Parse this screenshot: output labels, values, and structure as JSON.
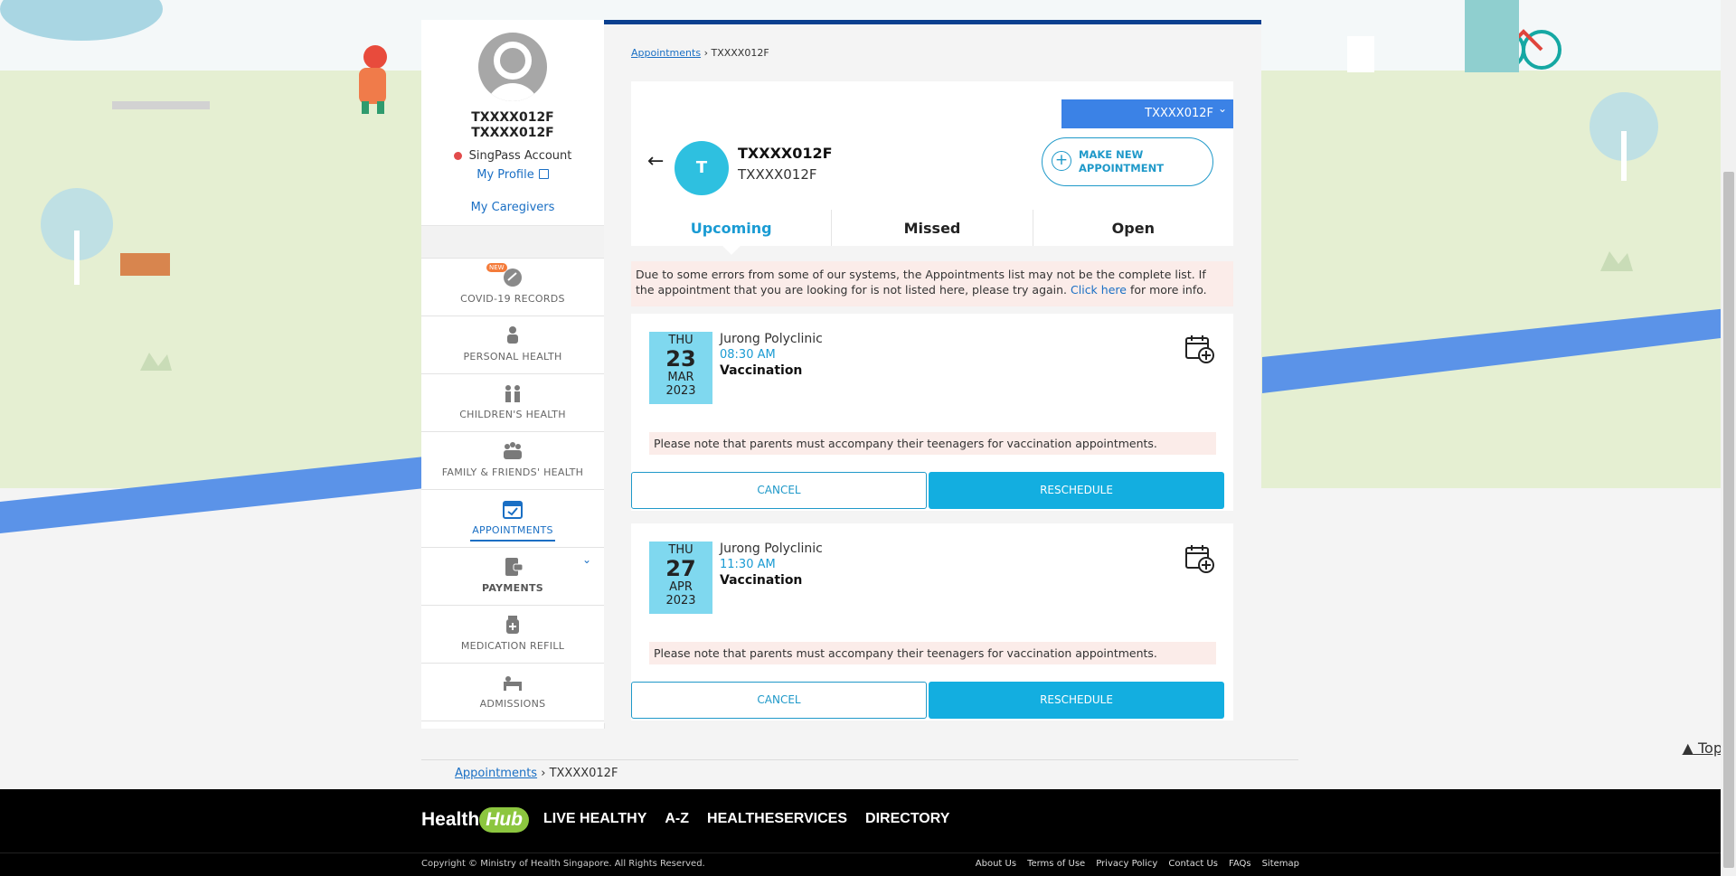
{
  "profile": {
    "name": "TXXXX012F",
    "id": "TXXXX012F",
    "account_type": "SingPass Account",
    "my_profile": "My Profile",
    "my_caregivers": "My Caregivers"
  },
  "sidebar": {
    "items": [
      {
        "label": "COVID-19 RECORDS",
        "icon": "covid-records-icon",
        "badge": "NEW"
      },
      {
        "label": "PERSONAL HEALTH",
        "icon": "person-heart-icon"
      },
      {
        "label": "CHILDREN'S HEALTH",
        "icon": "children-icon"
      },
      {
        "label": "FAMILY & FRIENDS' HEALTH",
        "icon": "family-icon"
      },
      {
        "label": "APPOINTMENTS",
        "icon": "calendar-check-icon",
        "active": true
      },
      {
        "label": "PAYMENTS",
        "icon": "payments-icon"
      },
      {
        "label": "MEDICATION REFILL",
        "icon": "medication-icon"
      },
      {
        "label": "ADMISSIONS",
        "icon": "admissions-icon"
      }
    ]
  },
  "breadcrumb": {
    "link": "Appointments",
    "sep": "›",
    "current": "TXXXX012F"
  },
  "header": {
    "selector": "TXXXX012F",
    "avatar_letter": "T",
    "name": "TXXXX012F",
    "sub": "TXXXX012F",
    "new_appt_line1": "MAKE NEW",
    "new_appt_line2": "APPOINTMENT",
    "tabs": [
      "Upcoming",
      "Missed",
      "Open"
    ]
  },
  "warning": {
    "text": "Due to some errors from some of our systems, the Appointments list may not be the complete list. If the appointment that you are looking for is not listed here, please try again.",
    "link": "Click here",
    "tail": "for more info."
  },
  "appointments": [
    {
      "dow": "THU",
      "day": "23",
      "month": "MAR",
      "year": "2023",
      "clinic": "Jurong Polyclinic",
      "time": "08:30 AM",
      "type": "Vaccination",
      "note": "Please note that parents must accompany their teenagers for vaccination appointments.",
      "cancel": "CANCEL",
      "reschedule": "RESCHEDULE"
    },
    {
      "dow": "THU",
      "day": "27",
      "month": "APR",
      "year": "2023",
      "clinic": "Jurong Polyclinic",
      "time": "11:30 AM",
      "type": "Vaccination",
      "note": "Please note that parents must accompany their teenagers for vaccination appointments.",
      "cancel": "CANCEL",
      "reschedule": "RESCHEDULE"
    }
  ],
  "bottom_crumb": {
    "link": "Appointments",
    "sep": "›",
    "current": "TXXXX012F"
  },
  "top_link": "Top",
  "footer": {
    "logo_health": "Health",
    "logo_hub": "Hub",
    "nav": [
      "LIVE HEALTHY",
      "A-Z",
      "HEALTHESERVICES",
      "DIRECTORY"
    ],
    "copyright": "Copyright © Ministry of Health Singapore. All Rights Reserved.",
    "links": [
      "About Us",
      "Terms of Use",
      "Privacy Policy",
      "Contact Us",
      "FAQs",
      "Sitemap"
    ]
  },
  "colors": {
    "accent": "#1a9bd3",
    "header_bar": "#0a3f8f",
    "selector": "#3b82e6",
    "date_box": "#7fd8ef",
    "warning_bg": "#fbece9"
  }
}
